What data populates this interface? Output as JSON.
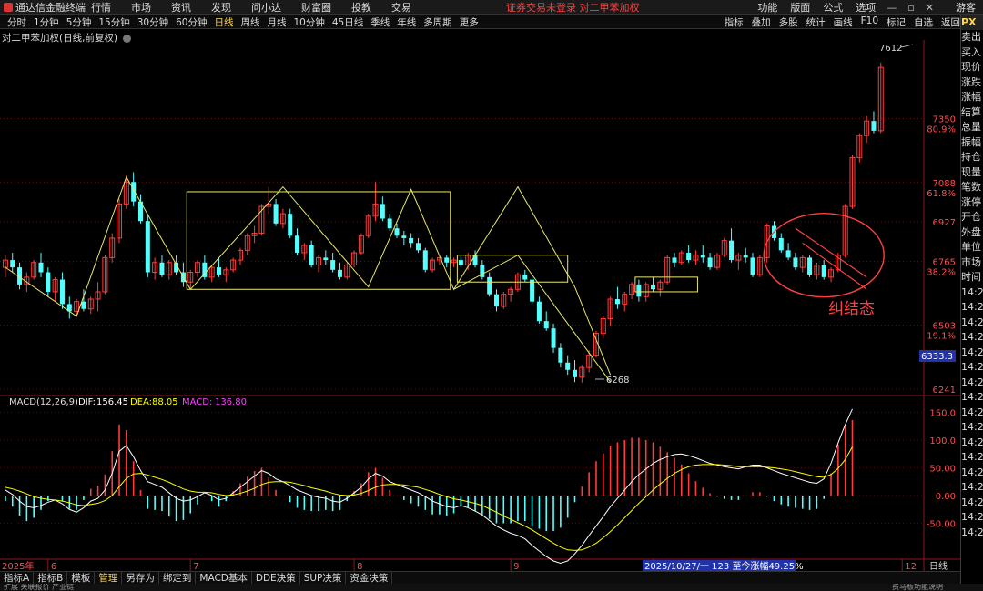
{
  "app": {
    "title": "通达信金融终端"
  },
  "menu": [
    "行情",
    "市场",
    "资讯",
    "发现",
    "问小达",
    "财富圈",
    "投教",
    "交易"
  ],
  "notice": "证券交易未登录 对二甲苯加权",
  "menu_right": [
    "功能",
    "版面",
    "公式",
    "选项",
    "游客"
  ],
  "periods": [
    "分时",
    "1分钟",
    "5分钟",
    "15分钟",
    "30分钟",
    "60分钟",
    "日线",
    "周线",
    "月线",
    "10分钟",
    "45日线",
    "季线",
    "年线",
    "多周期",
    "更多"
  ],
  "active_period": "日线",
  "tools": [
    "指标",
    "叠加",
    "多股",
    "统计",
    "画线",
    "F10",
    "标记",
    "自选",
    "返回"
  ],
  "chart_title": "对二甲苯加权(日线,前复权)",
  "macd_legend": {
    "name": "MACD(12,26,9)",
    "dif_label": "DIF:",
    "dif": "156.45",
    "dea_label": "DEA:",
    "dea": "88.05",
    "macd_label": "MACD:",
    "macd": "136.80"
  },
  "annotations": {
    "high": "7612",
    "low": "6268",
    "consolidation": "纠结态",
    "cursor_price": "6333.3",
    "range_info": "2025/10/27/一 123 至今涨幅49.25%",
    "period_box": "日线"
  },
  "price_axis": [
    {
      "price": "7350",
      "pct": "80.9%"
    },
    {
      "price": "7088",
      "pct": "61.8%"
    },
    {
      "price": "6927",
      "pct": ""
    },
    {
      "price": "6765",
      "pct": "38.2%"
    },
    {
      "price": "6503",
      "pct": "19.1%"
    },
    {
      "price": "6241",
      "pct": ""
    }
  ],
  "macd_axis": [
    "150.0",
    "100.0",
    "50.00",
    "0.00",
    "-50.00"
  ],
  "x_axis": [
    "2025年",
    "6",
    "7",
    "8",
    "9",
    "10",
    "11",
    "12"
  ],
  "bottom_tabs": [
    "指标A",
    "指标B",
    "模板",
    "管理",
    "另存为",
    "绑定到",
    "MACD基本",
    "DDE决策",
    "SUP决策",
    "资金决策"
  ],
  "active_bottom_tab": "管理",
  "status_text": "扩展 关联报价 产业链",
  "status_right": "费马版功能说明",
  "right_panel": {
    "header": "PX",
    "labels": [
      "卖出",
      "买入",
      "现价",
      "涨跌",
      "涨幅",
      "结算",
      "总量",
      "振幅",
      "持仓",
      "现量",
      "笔数",
      "涨停",
      "开仓",
      "外盘",
      "单位",
      "市场",
      "时间"
    ],
    "times": [
      "14:27",
      "14:27",
      "14:27",
      "14:27",
      "14:27",
      "14:27",
      "14:27",
      "14:27",
      "14:27",
      "14:27",
      "14:27",
      "14:27",
      "14:27",
      "14:27",
      "14:27",
      "14:27",
      "14:27"
    ]
  },
  "colors": {
    "up": "#ff3c3c",
    "down": "#54ffff",
    "dif": "#ffffff",
    "dea": "#ffff00",
    "macd_label": "#ff40ff",
    "annot": "#e8e86a",
    "circle": "#ff4040",
    "grid": "#8b1a1a"
  },
  "chart_data": {
    "type": "candlestick",
    "title": "对二甲苯加权(日线,前复权)",
    "ylim": [
      6241,
      7650
    ],
    "labeled_high": 7612,
    "labeled_low": 6268,
    "months": [
      {
        "label": "6",
        "index": 6
      },
      {
        "label": "7",
        "index": 26
      },
      {
        "label": "8",
        "index": 49
      },
      {
        "label": "9",
        "index": 71
      },
      {
        "label": "10",
        "index": 91
      },
      {
        "label": "11",
        "index": 105
      },
      {
        "label": "12",
        "index": 126
      }
    ],
    "candles": [
      [
        6740,
        6790,
        6700,
        6770
      ],
      [
        6770,
        6800,
        6720,
        6740
      ],
      [
        6740,
        6760,
        6650,
        6670
      ],
      [
        6670,
        6720,
        6640,
        6700
      ],
      [
        6700,
        6770,
        6690,
        6760
      ],
      [
        6760,
        6800,
        6700,
        6720
      ],
      [
        6720,
        6740,
        6620,
        6640
      ],
      [
        6640,
        6700,
        6600,
        6690
      ],
      [
        6690,
        6720,
        6570,
        6590
      ],
      [
        6590,
        6620,
        6530,
        6560
      ],
      [
        6560,
        6610,
        6540,
        6600
      ],
      [
        6600,
        6650,
        6560,
        6570
      ],
      [
        6570,
        6620,
        6550,
        6610
      ],
      [
        6610,
        6680,
        6560,
        6640
      ],
      [
        6640,
        6790,
        6630,
        6780
      ],
      [
        6780,
        6880,
        6760,
        6860
      ],
      [
        6860,
        7020,
        6840,
        7000
      ],
      [
        7000,
        7120,
        6980,
        7090
      ],
      [
        7090,
        7130,
        6990,
        7010
      ],
      [
        7010,
        7040,
        6920,
        6930
      ],
      [
        6930,
        6960,
        6700,
        6720
      ],
      [
        6720,
        6780,
        6690,
        6760
      ],
      [
        6760,
        6790,
        6700,
        6710
      ],
      [
        6710,
        6770,
        6690,
        6760
      ],
      [
        6760,
        6790,
        6710,
        6720
      ],
      [
        6720,
        6760,
        6660,
        6680
      ],
      [
        6680,
        6730,
        6650,
        6720
      ],
      [
        6720,
        6770,
        6700,
        6760
      ],
      [
        6760,
        6790,
        6690,
        6700
      ],
      [
        6700,
        6750,
        6680,
        6740
      ],
      [
        6740,
        6780,
        6700,
        6710
      ],
      [
        6710,
        6740,
        6680,
        6730
      ],
      [
        6730,
        6780,
        6720,
        6770
      ],
      [
        6770,
        6820,
        6750,
        6810
      ],
      [
        6810,
        6880,
        6790,
        6870
      ],
      [
        6870,
        6910,
        6840,
        6880
      ],
      [
        6880,
        7000,
        6870,
        6990
      ],
      [
        6990,
        7070,
        6960,
        7000
      ],
      [
        7000,
        7020,
        6910,
        6920
      ],
      [
        6920,
        6980,
        6900,
        6960
      ],
      [
        6960,
        6980,
        6860,
        6870
      ],
      [
        6870,
        6900,
        6790,
        6800
      ],
      [
        6800,
        6840,
        6770,
        6830
      ],
      [
        6830,
        6850,
        6740,
        6750
      ],
      [
        6750,
        6790,
        6720,
        6780
      ],
      [
        6780,
        6810,
        6750,
        6770
      ],
      [
        6770,
        6800,
        6720,
        6730
      ],
      [
        6730,
        6760,
        6690,
        6700
      ],
      [
        6700,
        6760,
        6690,
        6750
      ],
      [
        6750,
        6810,
        6740,
        6800
      ],
      [
        6800,
        6880,
        6790,
        6870
      ],
      [
        6870,
        6960,
        6860,
        6950
      ],
      [
        6950,
        7090,
        6930,
        7000
      ],
      [
        7000,
        7030,
        6930,
        6940
      ],
      [
        6940,
        6960,
        6890,
        6900
      ],
      [
        6900,
        6920,
        6860,
        6870
      ],
      [
        6870,
        6890,
        6830,
        6860
      ],
      [
        6860,
        6880,
        6820,
        6840
      ],
      [
        6840,
        6860,
        6800,
        6810
      ],
      [
        6810,
        6820,
        6720,
        6730
      ],
      [
        6730,
        6780,
        6720,
        6770
      ],
      [
        6770,
        6790,
        6750,
        6780
      ],
      [
        6780,
        6790,
        6740,
        6760
      ],
      [
        6760,
        6780,
        6740,
        6770
      ],
      [
        6770,
        6790,
        6740,
        6750
      ],
      [
        6750,
        6800,
        6730,
        6790
      ],
      [
        6790,
        6810,
        6740,
        6750
      ],
      [
        6750,
        6770,
        6690,
        6700
      ],
      [
        6700,
        6720,
        6620,
        6630
      ],
      [
        6630,
        6650,
        6560,
        6580
      ],
      [
        6580,
        6640,
        6570,
        6630
      ],
      [
        6630,
        6660,
        6600,
        6650
      ],
      [
        6650,
        6720,
        6640,
        6710
      ],
      [
        6710,
        6730,
        6680,
        6690
      ],
      [
        6690,
        6700,
        6590,
        6600
      ],
      [
        6600,
        6620,
        6510,
        6520
      ],
      [
        6520,
        6560,
        6480,
        6490
      ],
      [
        6490,
        6510,
        6390,
        6410
      ],
      [
        6410,
        6430,
        6330,
        6350
      ],
      [
        6350,
        6380,
        6300,
        6320
      ],
      [
        6320,
        6360,
        6270,
        6290
      ],
      [
        6290,
        6340,
        6268,
        6330
      ],
      [
        6330,
        6400,
        6310,
        6380
      ],
      [
        6380,
        6480,
        6370,
        6470
      ],
      [
        6470,
        6540,
        6450,
        6530
      ],
      [
        6530,
        6620,
        6500,
        6610
      ],
      [
        6610,
        6660,
        6570,
        6590
      ],
      [
        6590,
        6640,
        6560,
        6630
      ],
      [
        6630,
        6680,
        6610,
        6670
      ],
      [
        6670,
        6690,
        6600,
        6620
      ],
      [
        6620,
        6680,
        6600,
        6670
      ],
      [
        6670,
        6700,
        6640,
        6650
      ],
      [
        6650,
        6690,
        6620,
        6680
      ],
      [
        6680,
        6790,
        6670,
        6780
      ],
      [
        6780,
        6800,
        6740,
        6760
      ],
      [
        6760,
        6810,
        6750,
        6800
      ],
      [
        6800,
        6830,
        6760,
        6770
      ],
      [
        6770,
        6810,
        6750,
        6790
      ],
      [
        6790,
        6830,
        6760,
        6780
      ],
      [
        6780,
        6800,
        6730,
        6740
      ],
      [
        6740,
        6800,
        6730,
        6790
      ],
      [
        6790,
        6860,
        6780,
        6850
      ],
      [
        6850,
        6900,
        6760,
        6770
      ],
      [
        6770,
        6800,
        6730,
        6790
      ],
      [
        6790,
        6820,
        6760,
        6780
      ],
      [
        6780,
        6800,
        6700,
        6710
      ],
      [
        6710,
        6790,
        6700,
        6780
      ],
      [
        6780,
        6920,
        6760,
        6910
      ],
      [
        6910,
        6930,
        6850,
        6860
      ],
      [
        6860,
        6880,
        6800,
        6810
      ],
      [
        6810,
        6840,
        6770,
        6780
      ],
      [
        6780,
        6800,
        6730,
        6740
      ],
      [
        6740,
        6790,
        6720,
        6780
      ],
      [
        6780,
        6790,
        6700,
        6710
      ],
      [
        6710,
        6760,
        6690,
        6750
      ],
      [
        6750,
        6770,
        6690,
        6700
      ],
      [
        6700,
        6740,
        6680,
        6730
      ],
      [
        6730,
        6800,
        6720,
        6790
      ],
      [
        6790,
        7000,
        6780,
        6990
      ],
      [
        6990,
        7200,
        6980,
        7190
      ],
      [
        7190,
        7290,
        7170,
        7280
      ],
      [
        7280,
        7360,
        7250,
        7340
      ],
      [
        7340,
        7380,
        7290,
        7300
      ],
      [
        7300,
        7580,
        7290,
        7560
      ]
    ],
    "macd": {
      "dif": [
        10,
        2,
        -10,
        -20,
        -22,
        -18,
        -12,
        -8,
        -15,
        -25,
        -30,
        -22,
        -10,
        -5,
        10,
        40,
        80,
        90,
        70,
        45,
        25,
        20,
        15,
        5,
        -5,
        -10,
        -8,
        -2,
        5,
        0,
        -8,
        -5,
        5,
        15,
        25,
        35,
        45,
        40,
        30,
        25,
        18,
        10,
        5,
        0,
        -3,
        -5,
        -10,
        -12,
        -5,
        5,
        15,
        30,
        40,
        35,
        25,
        20,
        15,
        10,
        5,
        -2,
        -10,
        -15,
        -20,
        -22,
        -18,
        -22,
        -28,
        -35,
        -45,
        -55,
        -62,
        -68,
        -72,
        -78,
        -90,
        -100,
        -110,
        -118,
        -122,
        -118,
        -105,
        -90,
        -72,
        -55,
        -38,
        -20,
        -5,
        10,
        25,
        38,
        48,
        58,
        65,
        70,
        74,
        75,
        72,
        68,
        63,
        58,
        55,
        52,
        50,
        48,
        52,
        55,
        55,
        50,
        45,
        40,
        36,
        32,
        28,
        24,
        22,
        30,
        58,
        95,
        128,
        156
      ],
      "dea": [
        15,
        12,
        8,
        3,
        -2,
        -5,
        -7,
        -8,
        -10,
        -13,
        -17,
        -18,
        -16,
        -14,
        -9,
        0,
        16,
        31,
        39,
        40,
        37,
        33,
        29,
        24,
        18,
        12,
        8,
        6,
        6,
        5,
        2,
        0,
        1,
        4,
        8,
        13,
        20,
        24,
        25,
        25,
        24,
        21,
        18,
        14,
        11,
        8,
        4,
        1,
        0,
        1,
        4,
        9,
        15,
        19,
        20,
        20,
        19,
        17,
        15,
        11,
        7,
        2,
        -2,
        -6,
        -8,
        -11,
        -14,
        -18,
        -24,
        -30,
        -37,
        -43,
        -49,
        -55,
        -62,
        -70,
        -78,
        -86,
        -93,
        -98,
        -99,
        -98,
        -93,
        -86,
        -76,
        -65,
        -53,
        -40,
        -27,
        -14,
        -2,
        10,
        21,
        31,
        40,
        47,
        52,
        55,
        56,
        56,
        56,
        55,
        54,
        52,
        52,
        52,
        52,
        51,
        50,
        48,
        46,
        43,
        40,
        37,
        34,
        33,
        38,
        49,
        65,
        88
      ]
    }
  }
}
